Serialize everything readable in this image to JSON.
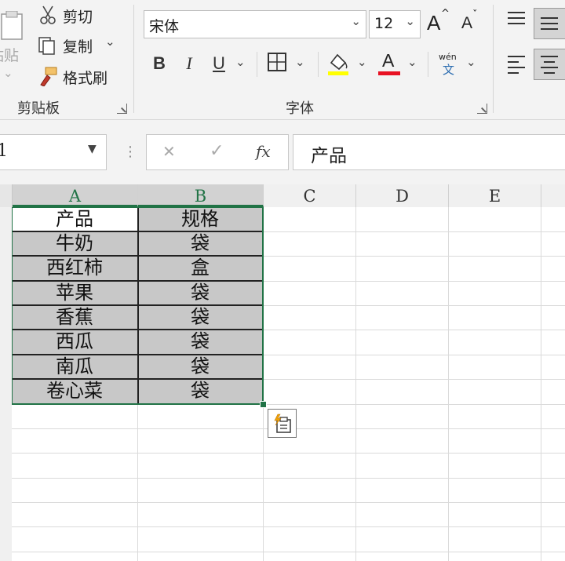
{
  "ribbon": {
    "clipboard": {
      "paste_label": "粘贴",
      "cut_label": "剪切",
      "copy_label": "复制",
      "format_painter_label": "格式刷",
      "group_label": "剪贴板"
    },
    "font": {
      "font_name": "宋体",
      "font_size": "12",
      "group_label": "字体",
      "bold": "B",
      "italic": "I",
      "underline": "U",
      "font_color_letter": "A",
      "grow_font": "A",
      "shrink_font": "A",
      "phonetic_top": "wén",
      "phonetic_bottom": "文",
      "fill_color": "#ffff00",
      "font_color": "#ff0000"
    }
  },
  "formula_bar": {
    "name_box": "1",
    "cancel": "✕",
    "enter": "✓",
    "fx": "fx",
    "content": "产品"
  },
  "sheet": {
    "columns": [
      "A",
      "B",
      "C",
      "D",
      "E"
    ],
    "header": [
      "产品",
      "规格"
    ],
    "rows": [
      [
        "牛奶",
        "袋"
      ],
      [
        "西红柿",
        "盒"
      ],
      [
        "苹果",
        "袋"
      ],
      [
        "香蕉",
        "袋"
      ],
      [
        "西瓜",
        "袋"
      ],
      [
        "南瓜",
        "袋"
      ],
      [
        "卷心菜",
        "袋"
      ]
    ],
    "accent": "#217346",
    "selection_fill": "#c8c8c8"
  },
  "paste_options_icon": "paste-options-icon"
}
